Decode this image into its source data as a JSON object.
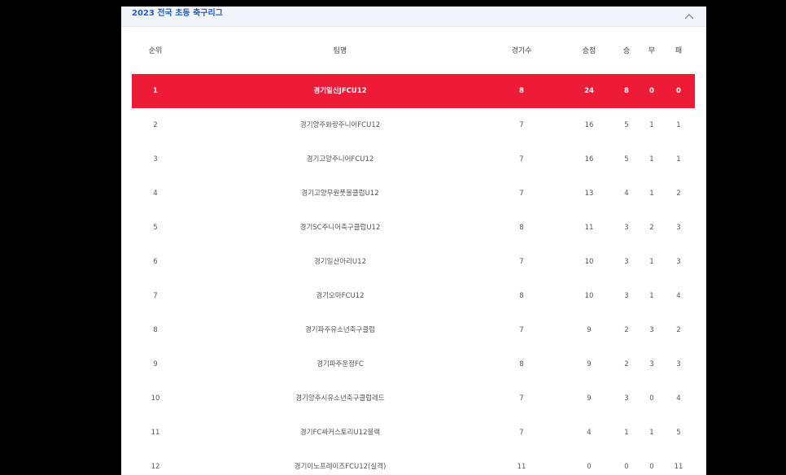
{
  "panel": {
    "title": "2023 전국 초등 축구리그"
  },
  "columns": {
    "rank": "순위",
    "team": "팀명",
    "played": "경기수",
    "points": "승점",
    "wins": "승",
    "draws": "무",
    "losses": "패"
  },
  "colors": {
    "highlight": "#ee1b36",
    "title": "#1f5fbf"
  },
  "standings": [
    {
      "rank": "1",
      "team": "경기일신JFCU12",
      "played": "8",
      "points": "24",
      "wins": "8",
      "draws": "0",
      "losses": "0",
      "highlight": true
    },
    {
      "rank": "2",
      "team": "경기양주화랑주니어FCU12",
      "played": "7",
      "points": "16",
      "wins": "5",
      "draws": "1",
      "losses": "1"
    },
    {
      "rank": "3",
      "team": "경기고양주니어FCU12",
      "played": "7",
      "points": "16",
      "wins": "5",
      "draws": "1",
      "losses": "1"
    },
    {
      "rank": "4",
      "team": "경기고양무원풋볼클럽U12",
      "played": "7",
      "points": "13",
      "wins": "4",
      "draws": "1",
      "losses": "2"
    },
    {
      "rank": "5",
      "team": "경기SC주니어축구클럽U12",
      "played": "8",
      "points": "11",
      "wins": "3",
      "draws": "2",
      "losses": "3"
    },
    {
      "rank": "6",
      "team": "경기일산아리U12",
      "played": "7",
      "points": "10",
      "wins": "3",
      "draws": "1",
      "losses": "3"
    },
    {
      "rank": "7",
      "team": "경기오마FCU12",
      "played": "8",
      "points": "10",
      "wins": "3",
      "draws": "1",
      "losses": "4"
    },
    {
      "rank": "8",
      "team": "경기파주유소년축구클럽",
      "played": "7",
      "points": "9",
      "wins": "2",
      "draws": "3",
      "losses": "2"
    },
    {
      "rank": "9",
      "team": "경기파주운정FC",
      "played": "8",
      "points": "9",
      "wins": "2",
      "draws": "3",
      "losses": "3"
    },
    {
      "rank": "10",
      "team": "경기양주시유소년축구클럽레드",
      "played": "7",
      "points": "9",
      "wins": "3",
      "draws": "0",
      "losses": "4"
    },
    {
      "rank": "11",
      "team": "경기FC싸커스토리U12블랙",
      "played": "7",
      "points": "4",
      "wins": "1",
      "draws": "1",
      "losses": "5"
    },
    {
      "rank": "12",
      "team": "경기이노프레이즈FCU12(실격)",
      "played": "11",
      "points": "0",
      "wins": "0",
      "draws": "0",
      "losses": "11"
    }
  ]
}
